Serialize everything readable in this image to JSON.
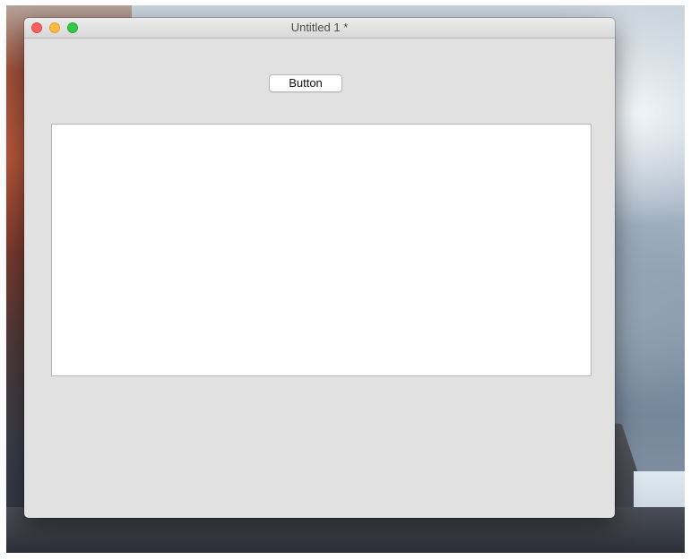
{
  "window": {
    "title": "Untitled 1 *",
    "controls": [
      "close-icon",
      "minimize-icon",
      "zoom-icon"
    ]
  },
  "content": {
    "button_label": "Button",
    "text_area": {
      "value": "",
      "placeholder": ""
    }
  },
  "colors": {
    "close": "#fc605c",
    "minimize": "#fdbc40",
    "zoom": "#34c84a",
    "window_background": "#e1e1e1"
  }
}
